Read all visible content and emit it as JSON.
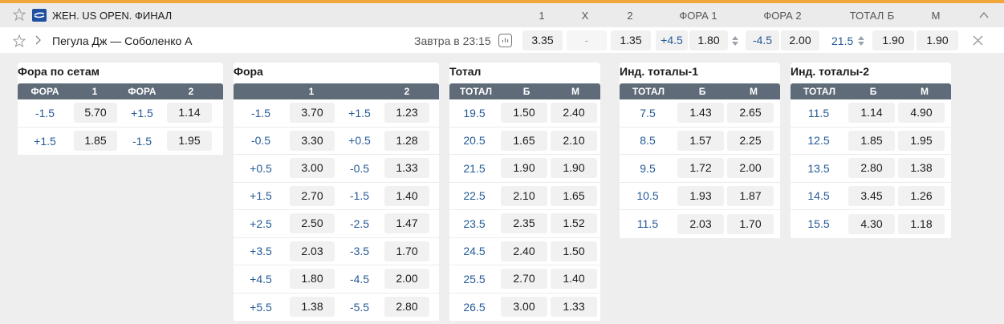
{
  "league": {
    "title": "ЖЕН. US OPEN. ФИНАЛ",
    "headers": [
      "1",
      "X",
      "2",
      "ФОРА 1",
      "ФОРА 2",
      "ТОТАЛ",
      "Б",
      "М"
    ]
  },
  "event": {
    "name": "Пегула Дж — Соболенко А",
    "start_time": "Завтра в 23:15",
    "odds": {
      "w1": "3.35",
      "draw": "-",
      "w2": "1.35",
      "fora1_line": "+4.5",
      "fora1_odd": "1.80",
      "fora2_line": "-4.5",
      "fora2_odd": "2.00",
      "total_line": "21.5",
      "over": "1.90",
      "under": "1.90"
    }
  },
  "panels": {
    "fora_sets": {
      "title": "Фора по сетам",
      "headers": [
        "ФОРА",
        "1",
        "ФОРА",
        "2"
      ],
      "rows": [
        [
          "-1.5",
          "5.70",
          "+1.5",
          "1.14"
        ],
        [
          "+1.5",
          "1.85",
          "-1.5",
          "1.95"
        ]
      ]
    },
    "fora": {
      "title": "Фора",
      "headers": [
        "",
        "1",
        "",
        "2"
      ],
      "rows": [
        [
          "-1.5",
          "3.70",
          "+1.5",
          "1.23"
        ],
        [
          "-0.5",
          "3.30",
          "+0.5",
          "1.28"
        ],
        [
          "+0.5",
          "3.00",
          "-0.5",
          "1.33"
        ],
        [
          "+1.5",
          "2.70",
          "-1.5",
          "1.40"
        ],
        [
          "+2.5",
          "2.50",
          "-2.5",
          "1.47"
        ],
        [
          "+3.5",
          "2.03",
          "-3.5",
          "1.70"
        ],
        [
          "+4.5",
          "1.80",
          "-4.5",
          "2.00"
        ],
        [
          "+5.5",
          "1.38",
          "-5.5",
          "2.80"
        ]
      ]
    },
    "total": {
      "title": "Тотал",
      "headers": [
        "ТОТАЛ",
        "Б",
        "М"
      ],
      "rows": [
        [
          "19.5",
          "1.50",
          "2.40"
        ],
        [
          "20.5",
          "1.65",
          "2.10"
        ],
        [
          "21.5",
          "1.90",
          "1.90"
        ],
        [
          "22.5",
          "2.10",
          "1.65"
        ],
        [
          "23.5",
          "2.35",
          "1.52"
        ],
        [
          "24.5",
          "2.40",
          "1.50"
        ],
        [
          "25.5",
          "2.70",
          "1.40"
        ],
        [
          "26.5",
          "3.00",
          "1.33"
        ]
      ]
    },
    "ind_total_1": {
      "title": "Инд. тоталы-1",
      "headers": [
        "ТОТАЛ",
        "Б",
        "М"
      ],
      "rows": [
        [
          "7.5",
          "1.43",
          "2.65"
        ],
        [
          "8.5",
          "1.57",
          "2.25"
        ],
        [
          "9.5",
          "1.72",
          "2.00"
        ],
        [
          "10.5",
          "1.93",
          "1.87"
        ],
        [
          "11.5",
          "2.03",
          "1.70"
        ]
      ]
    },
    "ind_total_2": {
      "title": "Инд. тоталы-2",
      "headers": [
        "ТОТАЛ",
        "Б",
        "М"
      ],
      "rows": [
        [
          "11.5",
          "1.14",
          "4.90"
        ],
        [
          "12.5",
          "1.85",
          "1.95"
        ],
        [
          "13.5",
          "2.80",
          "1.38"
        ],
        [
          "14.5",
          "3.45",
          "1.26"
        ],
        [
          "15.5",
          "4.30",
          "1.18"
        ]
      ]
    }
  },
  "colors": {
    "accent_stripe": "#f0a63a",
    "table_header": "#5f6b78",
    "line_text": "#245a96"
  }
}
